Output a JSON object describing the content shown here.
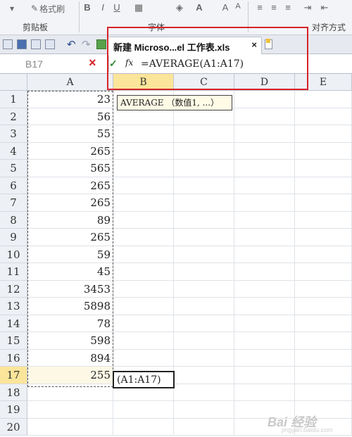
{
  "ribbon": {
    "format_painter": "格式刷",
    "clipboard_label": "剪贴板",
    "font_label": "字体",
    "align_label": "对齐方式"
  },
  "tab": {
    "title": "新建 Microso...el 工作表.xls",
    "close": "×"
  },
  "formula_bar": {
    "name_box": "B17",
    "cancel": "×",
    "confirm": "✓",
    "fx": "fx",
    "formula": "=AVERAGE(A1:A17)"
  },
  "sheet": {
    "columns": [
      "A",
      "B",
      "C",
      "D",
      "E"
    ],
    "active_column": "B",
    "active_row": 17,
    "rows": [
      {
        "row": "1",
        "a": "23"
      },
      {
        "row": "2",
        "a": "56"
      },
      {
        "row": "3",
        "a": "55"
      },
      {
        "row": "4",
        "a": "265"
      },
      {
        "row": "5",
        "a": "565"
      },
      {
        "row": "6",
        "a": "265"
      },
      {
        "row": "7",
        "a": "265"
      },
      {
        "row": "8",
        "a": "89"
      },
      {
        "row": "9",
        "a": "265"
      },
      {
        "row": "10",
        "a": "59"
      },
      {
        "row": "11",
        "a": "45"
      },
      {
        "row": "12",
        "a": "3453"
      },
      {
        "row": "13",
        "a": "5898"
      },
      {
        "row": "14",
        "a": "78"
      },
      {
        "row": "15",
        "a": "598"
      },
      {
        "row": "16",
        "a": "894"
      },
      {
        "row": "17",
        "a": "255"
      },
      {
        "row": "18",
        "a": ""
      },
      {
        "row": "19",
        "a": ""
      },
      {
        "row": "20",
        "a": ""
      }
    ]
  },
  "tooltip": "AVERAGE （数值1, ...）",
  "edit_cell": "(A1:A17)",
  "watermark": "Bai 经验",
  "watermark_sub": "jingyan.baidu.com",
  "colors": {
    "highlight": "#d6232a",
    "active_header": "#fbe59a",
    "cancel": "#d6232a",
    "confirm": "#2e8b2e"
  }
}
